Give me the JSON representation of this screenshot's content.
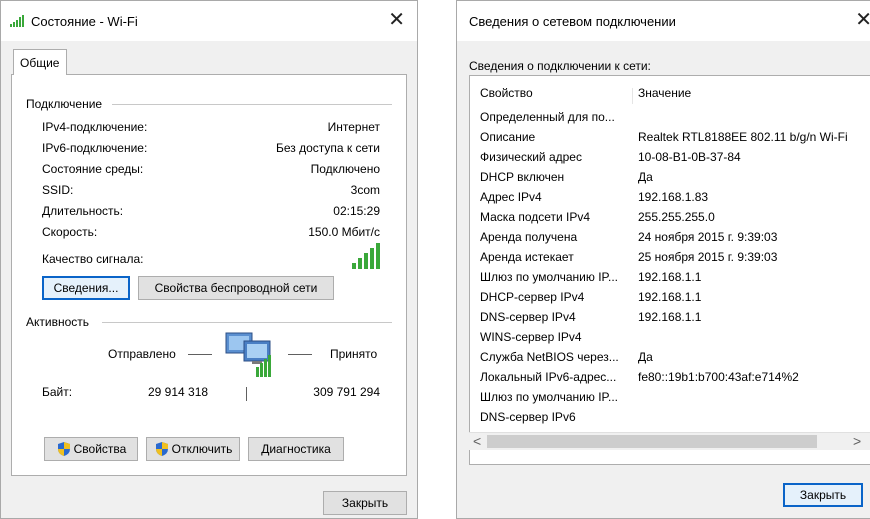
{
  "left": {
    "title": "Состояние - Wi-Fi",
    "close": "✕",
    "tab": "Общие",
    "connection": {
      "header": "Подключение",
      "rows": [
        {
          "label": "IPv4-подключение:",
          "value": "Интернет"
        },
        {
          "label": "IPv6-подключение:",
          "value": "Без доступа к сети"
        },
        {
          "label": "Состояние среды:",
          "value": "Подключено"
        },
        {
          "label": "SSID:",
          "value": "3com"
        },
        {
          "label": "Длительность:",
          "value": "02:15:29"
        },
        {
          "label": "Скорость:",
          "value": "150.0 Мбит/с"
        }
      ],
      "signal_label": "Качество сигнала:",
      "signal_bars": 5
    },
    "buttons": {
      "details": "Сведения...",
      "wireless_props": "Свойства беспроводной сети"
    },
    "activity": {
      "header": "Активность",
      "sent_label": "Отправлено",
      "received_label": "Принято",
      "bytes_label": "Байт:",
      "sent": "29 914 318",
      "received": "309 791 294"
    },
    "bottom_buttons": {
      "properties": "Свойства",
      "disable": "Отключить",
      "diagnose": "Диагностика"
    },
    "close_button": "Закрыть"
  },
  "right": {
    "title": "Сведения о сетевом подключении",
    "close": "✕",
    "section": "Сведения о подключении к сети:",
    "columns": [
      "Свойство",
      "Значение"
    ],
    "rows": [
      {
        "prop": "Определенный для по...",
        "value": ""
      },
      {
        "prop": "Описание",
        "value": "Realtek RTL8188EE 802.11 b/g/n Wi-Fi"
      },
      {
        "prop": "Физический адрес",
        "value": "10-08-B1-0B-37-84"
      },
      {
        "prop": "DHCP включен",
        "value": "Да"
      },
      {
        "prop": "Адрес IPv4",
        "value": "192.168.1.83"
      },
      {
        "prop": "Маска подсети IPv4",
        "value": "255.255.255.0"
      },
      {
        "prop": "Аренда получена",
        "value": "24 ноября 2015 г. 9:39:03"
      },
      {
        "prop": "Аренда истекает",
        "value": "25 ноября 2015 г. 9:39:03"
      },
      {
        "prop": "Шлюз по умолчанию IP...",
        "value": "192.168.1.1"
      },
      {
        "prop": "DHCP-сервер IPv4",
        "value": "192.168.1.1"
      },
      {
        "prop": "DNS-сервер IPv4",
        "value": "192.168.1.1"
      },
      {
        "prop": "WINS-сервер IPv4",
        "value": ""
      },
      {
        "prop": "Служба NetBIOS через...",
        "value": "Да"
      },
      {
        "prop": "Локальный IPv6-адрес...",
        "value": "fe80::19b1:b700:43af:e714%2"
      },
      {
        "prop": "Шлюз по умолчанию IP...",
        "value": ""
      },
      {
        "prop": "DNS-сервер IPv6",
        "value": ""
      }
    ],
    "scroll_left": "<",
    "scroll_right": ">",
    "close_button": "Закрыть"
  },
  "colors": {
    "accent": "#0a64c8",
    "signal": "#3aa83a"
  }
}
